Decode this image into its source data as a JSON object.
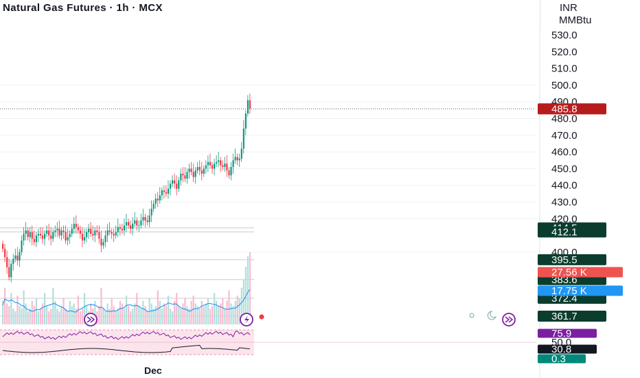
{
  "header": {
    "title": "Natural Gas Futures · 1h · MCX",
    "currency": "INR",
    "unit": "MMBtu"
  },
  "x_axis": {
    "month_label": "Dec"
  },
  "price_axis": {
    "ticks": [
      "530.0",
      "520.0",
      "510.0",
      "500.0",
      "490.0",
      "480.0",
      "470.0",
      "460.0",
      "450.0",
      "440.0",
      "430.0",
      "420.0",
      "400.0"
    ]
  },
  "price_labels": [
    {
      "name": "last-price-label",
      "text": "485.8",
      "price": 485.8,
      "bg": "#b71c1c",
      "fg": "#ffffff"
    },
    {
      "name": "level-label-414",
      "text": "414.5",
      "price": 414.5,
      "bg": "#0b3d2e",
      "fg": "#ffffff"
    },
    {
      "name": "level-label-412",
      "text": "412.1",
      "price": 412.1,
      "bg": "#0b3d2e",
      "fg": "#ffffff"
    },
    {
      "name": "level-label-395",
      "text": "395.5",
      "price": 395.5,
      "bg": "#0b3d2e",
      "fg": "#ffffff"
    },
    {
      "name": "level-label-383",
      "text": "383.6",
      "price": 383.6,
      "bg": "#0b3d2e",
      "fg": "#ffffff"
    },
    {
      "name": "level-label-372",
      "text": "372.4",
      "price": 372.4,
      "bg": "#0b3d2e",
      "fg": "#ffffff"
    },
    {
      "name": "level-label-361",
      "text": "361.7",
      "price": 361.7,
      "bg": "#0b3d2e",
      "fg": "#ffffff"
    }
  ],
  "indicator_labels": [
    {
      "name": "volume-label",
      "text": "27.56 K",
      "bg": "#ef5350",
      "fg": "#ffffff"
    },
    {
      "name": "volume-ma-label",
      "text": "17.75 K",
      "bg": "#2196f3",
      "fg": "#ffffff"
    }
  ],
  "oscillator_labels": [
    {
      "name": "rsi-value-label",
      "text": "75.9",
      "value": 75.9,
      "bg": "#7b1fa2",
      "fg": "#ffffff"
    },
    {
      "name": "rsi-mid-label",
      "text": "50.0",
      "value": 50.0,
      "bg": "#ffffff",
      "fg": "#131722"
    },
    {
      "name": "rsi-signal-label",
      "text": "30.8",
      "value": 30.8,
      "bg": "#131722",
      "fg": "#ffffff"
    },
    {
      "name": "extra-value-label",
      "text": "0.3",
      "value": 0.3,
      "bg": "#00897b",
      "fg": "#ffffff"
    }
  ],
  "colors": {
    "up": "#089981",
    "down": "#f23645",
    "volume_up": "#b2dfdb",
    "volume_down": "#f8bbd0",
    "volume_ma": "#2196f3",
    "rsi_line": "#7b1fa2",
    "rsi_band": "#fce4ec",
    "signal_line": "#131722",
    "grid": "#e0e3eb",
    "accent": "#7b1fa2"
  },
  "icons": [
    "fast-forward-icon",
    "lightning-icon",
    "sun-icon",
    "moon-icon"
  ],
  "chart_data": {
    "type": "candlestick",
    "title": "Natural Gas Futures · 1h · MCX",
    "y_unit": "INR / MMBtu",
    "ylim": [
      360,
      535
    ],
    "grid": true,
    "last_price": 485.8,
    "horizontal_levels": [
      414.5,
      412.1,
      395.5,
      383.6,
      372.4,
      361.7
    ],
    "month_label": "Dec",
    "close": [
      402,
      397,
      391,
      385,
      393,
      396,
      398,
      395,
      400,
      407,
      411,
      413,
      409,
      412,
      408,
      406,
      410,
      411,
      410,
      408,
      411,
      413,
      410,
      408,
      412,
      413,
      414,
      410,
      413,
      412,
      407,
      409,
      411,
      414,
      417,
      415,
      413,
      411,
      407,
      409,
      412,
      414,
      411,
      410,
      413,
      412,
      408,
      404,
      406,
      410,
      413,
      412,
      411,
      410,
      412,
      415,
      414,
      413,
      416,
      418,
      416,
      414,
      417,
      419,
      416,
      416,
      419,
      421,
      419,
      418,
      422,
      426,
      429,
      432,
      431,
      434,
      437,
      436,
      435,
      438,
      441,
      443,
      441,
      438,
      443,
      447,
      446,
      444,
      448,
      450,
      448,
      445,
      449,
      451,
      449,
      447,
      450,
      452,
      454,
      452,
      450,
      453,
      454,
      455,
      452,
      451,
      453,
      449,
      446,
      451,
      455,
      457,
      455,
      456,
      462,
      474,
      483,
      491,
      485.8
    ],
    "volume": [
      9000,
      14000,
      8000,
      7000,
      12000,
      6000,
      5000,
      11000,
      7000,
      6000,
      13000,
      8000,
      5000,
      6000,
      9000,
      7000,
      10000,
      5000,
      6000,
      8000,
      12000,
      7000,
      5000,
      6000,
      14000,
      9000,
      6000,
      5000,
      7000,
      10000,
      6000,
      5000,
      9000,
      7000,
      8000,
      6000,
      11000,
      5000,
      6000,
      12000,
      7000,
      5000,
      8000,
      6000,
      9000,
      5000,
      7000,
      14000,
      6000,
      5000,
      8000,
      6000,
      10000,
      7000,
      5000,
      6000,
      9000,
      8000,
      6000,
      11000,
      7000,
      5000,
      6000,
      8000,
      12000,
      7000,
      6000,
      9000,
      7000,
      5000,
      10000,
      8000,
      6000,
      7000,
      13000,
      9000,
      6000,
      8000,
      7000,
      11000,
      6000,
      5000,
      9000,
      12000,
      7000,
      6000,
      8000,
      10000,
      7000,
      6000,
      9000,
      11000,
      8000,
      7000,
      6000,
      9000,
      7000,
      8000,
      10000,
      6000,
      7000,
      12000,
      9000,
      7000,
      8000,
      10000,
      6000,
      9000,
      13000,
      8000,
      7000,
      9000,
      11000,
      10000,
      14000,
      17000,
      22000,
      26000,
      27560
    ],
    "volume_ma": [
      17750
    ],
    "rsi": [
      75.9
    ],
    "rsi_signal": [
      30.8
    ],
    "rsi_mid": 50.0,
    "extra_indicator": 0.3
  }
}
